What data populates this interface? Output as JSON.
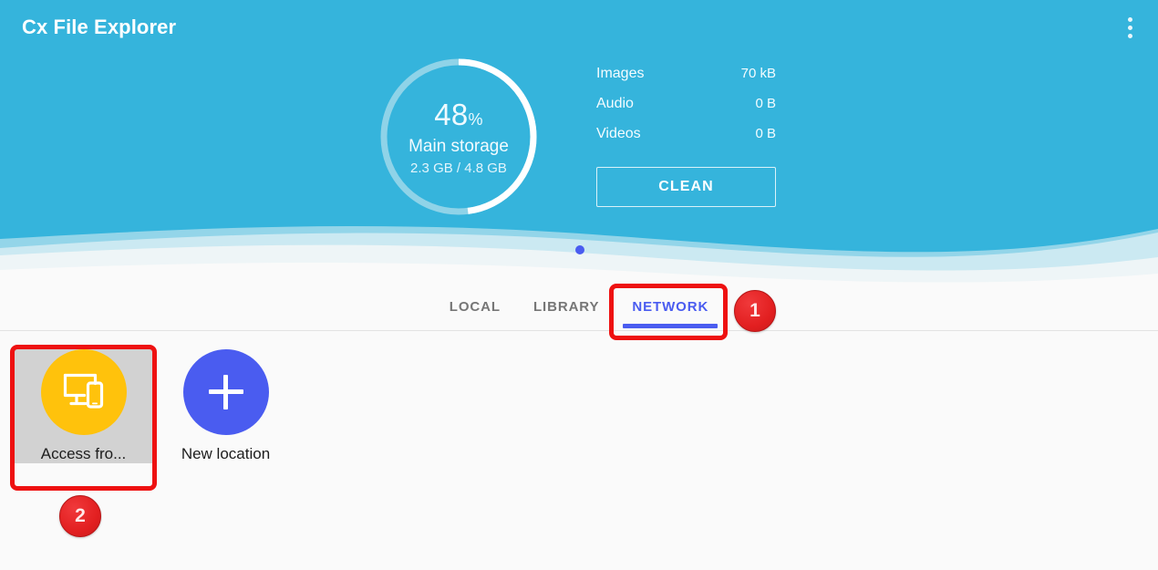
{
  "header": {
    "app_title": "Cx File Explorer",
    "overflow_icon": "more-vertical-icon",
    "bg_color": "#35b4dc",
    "wave_mid_color": "#b9e2ef",
    "wave_pale_color": "#e9f3f6"
  },
  "storage": {
    "percent_value": "48",
    "percent_symbol": "%",
    "percent_number": 48,
    "label": "Main storage",
    "sub": "2.3 GB / 4.8 GB",
    "used": "2.3 GB",
    "total": "4.8 GB",
    "ring_track_color": "#8fd3e8",
    "ring_fill_color": "#ffffff"
  },
  "stats": {
    "rows": [
      {
        "name": "Images",
        "value": "70 kB"
      },
      {
        "name": "Audio",
        "value": "0 B"
      },
      {
        "name": "Videos",
        "value": "0 B"
      }
    ],
    "clean_label": "CLEAN"
  },
  "pager": {
    "dot_color": "#4a5cf0"
  },
  "tabs": {
    "items": [
      {
        "label": "LOCAL",
        "active": false
      },
      {
        "label": "LIBRARY",
        "active": false
      },
      {
        "label": "NETWORK",
        "active": true
      }
    ],
    "active_color": "#4a5cf0",
    "inactive_color": "#767676"
  },
  "content": {
    "tiles": [
      {
        "label": "Access fro...",
        "icon": "desktop-and-phone-icon",
        "circle_color": "#ffc20c",
        "selected": true
      },
      {
        "label": "New location",
        "icon": "plus-icon",
        "circle_color": "#4a5cf0",
        "selected": false
      }
    ]
  },
  "annotations": {
    "badges": [
      {
        "number": "1",
        "target": "network-tab"
      },
      {
        "number": "2",
        "target": "access-from-tile"
      }
    ],
    "box_color": "#ee1111",
    "badge_color": "#e21f20"
  }
}
